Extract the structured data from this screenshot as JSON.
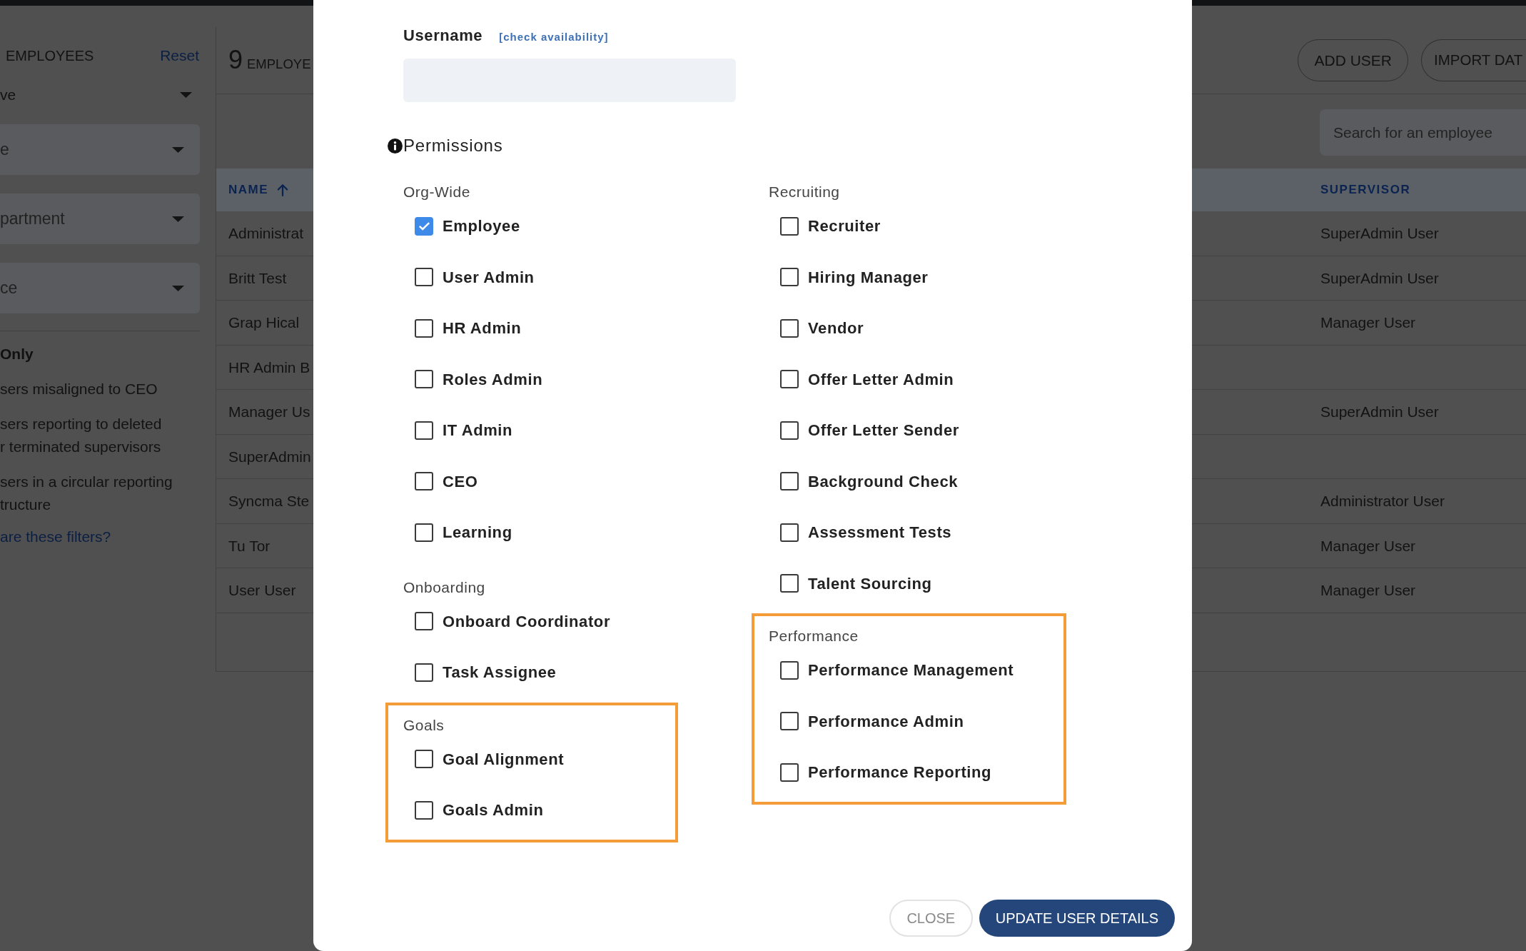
{
  "sidebar": {
    "title": "EMPLOYEES",
    "reset": "Reset",
    "filters": [
      {
        "kind": "plain",
        "value": "ve"
      },
      {
        "kind": "filled",
        "placeholder": "e"
      },
      {
        "kind": "filled",
        "placeholder": "partment"
      },
      {
        "kind": "filled",
        "placeholder": "ce"
      }
    ],
    "section_title": "Only",
    "options": [
      "sers misaligned to CEO",
      "sers reporting to deleted\nr terminated supervisors",
      "sers in a circular reporting\ntructure"
    ],
    "help_link": "are these filters?"
  },
  "header": {
    "count": "9",
    "label": "EMPLOYE",
    "buttons": [
      "ADD USER",
      "IMPORT DAT"
    ]
  },
  "search": {
    "placeholder": "Search for an employee"
  },
  "table": {
    "columns": [
      {
        "label": "NAME",
        "sorted": true
      },
      {
        "label": "SUPERVISOR",
        "sorted": false
      }
    ],
    "rows": [
      {
        "name": "Administrat",
        "supervisor": "SuperAdmin User"
      },
      {
        "name": "Britt Test",
        "supervisor": "SuperAdmin User"
      },
      {
        "name": "Grap Hical",
        "supervisor": "Manager User"
      },
      {
        "name": "HR Admin B"
      },
      {
        "name": "Manager Us",
        "supervisor": "SuperAdmin User"
      },
      {
        "name": "SuperAdmin"
      },
      {
        "name": "Syncma Ste",
        "supervisor": "Administrator User"
      },
      {
        "name": "Tu Tor",
        "supervisor": "Manager User"
      },
      {
        "name": "User User",
        "supervisor": "Manager User"
      }
    ]
  },
  "dialog": {
    "username": {
      "label": "Username",
      "link": "[check availability]"
    },
    "permissions": {
      "title": "Permissions",
      "columns": [
        {
          "groups": [
            {
              "title": "Org-Wide",
              "highlighted": false,
              "items": [
                {
                  "label": "Employee",
                  "checked": true
                },
                {
                  "label": "User Admin",
                  "checked": false
                },
                {
                  "label": "HR Admin",
                  "checked": false
                },
                {
                  "label": "Roles Admin",
                  "checked": false
                },
                {
                  "label": "IT Admin",
                  "checked": false
                },
                {
                  "label": "CEO",
                  "checked": false
                },
                {
                  "label": "Learning",
                  "checked": false
                }
              ]
            },
            {
              "title": "Onboarding",
              "highlighted": false,
              "items": [
                {
                  "label": "Onboard Coordinator",
                  "checked": false
                },
                {
                  "label": "Task Assignee",
                  "checked": false
                }
              ]
            },
            {
              "title": "Goals",
              "highlighted": true,
              "items": [
                {
                  "label": "Goal Alignment",
                  "checked": false
                },
                {
                  "label": "Goals Admin",
                  "checked": false
                }
              ]
            }
          ]
        },
        {
          "groups": [
            {
              "title": "Recruiting",
              "highlighted": false,
              "items": [
                {
                  "label": "Recruiter",
                  "checked": false
                },
                {
                  "label": "Hiring Manager",
                  "checked": false
                },
                {
                  "label": "Vendor",
                  "checked": false
                },
                {
                  "label": "Offer Letter Admin",
                  "checked": false
                },
                {
                  "label": "Offer Letter Sender",
                  "checked": false
                },
                {
                  "label": "Background Check",
                  "checked": false
                },
                {
                  "label": "Assessment Tests",
                  "checked": false
                },
                {
                  "label": "Talent Sourcing",
                  "checked": false
                }
              ]
            },
            {
              "title": "Performance",
              "highlighted": true,
              "items": [
                {
                  "label": "Performance Management",
                  "checked": false
                },
                {
                  "label": "Performance Admin",
                  "checked": false
                },
                {
                  "label": "Performance Reporting",
                  "checked": false
                }
              ]
            }
          ]
        }
      ]
    },
    "buttons": [
      {
        "label": "CLOSE",
        "kind": "secondary"
      },
      {
        "label": "UPDATE USER DETAILS",
        "kind": "primary"
      }
    ]
  }
}
